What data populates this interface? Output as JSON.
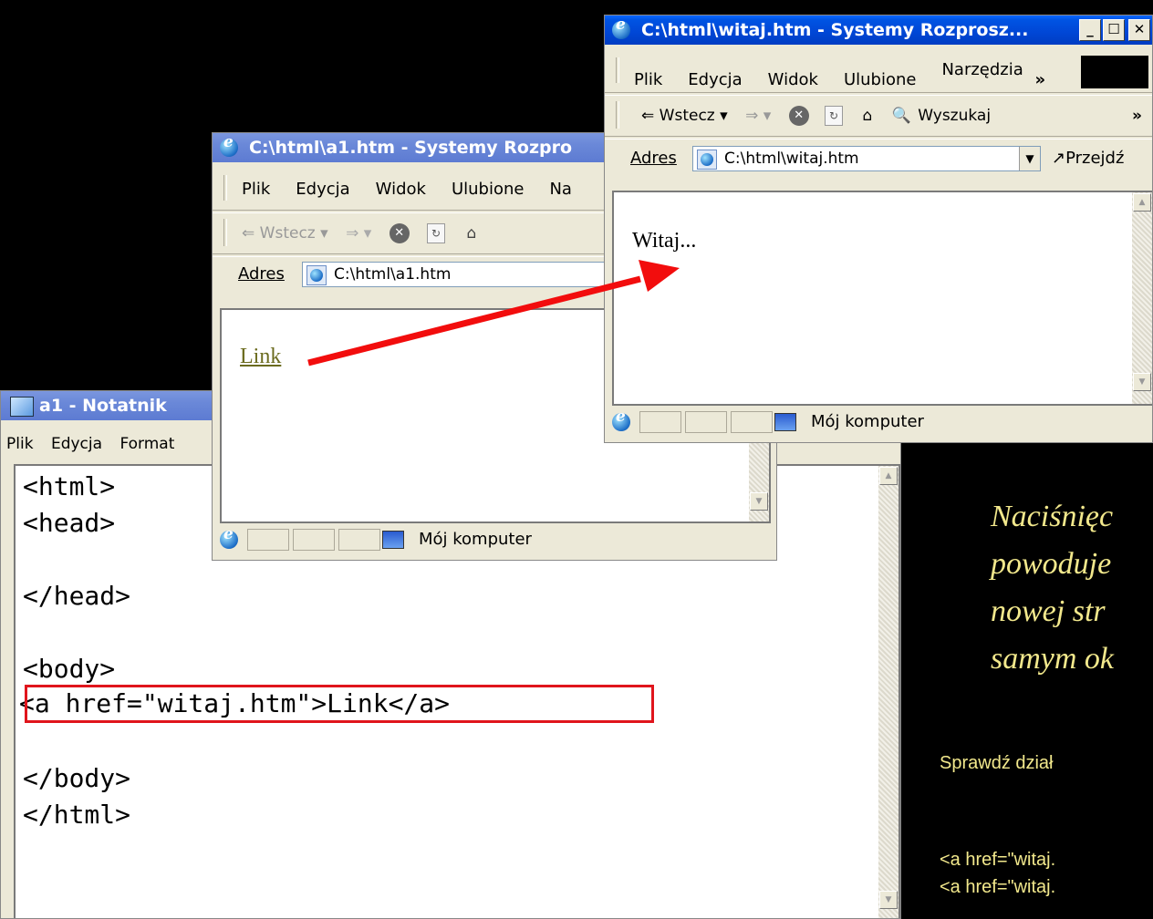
{
  "notepad": {
    "title": "a1 - Notatnik",
    "menu": [
      "Plik",
      "Edycja",
      "Format"
    ],
    "lines": [
      "<html>",
      "<head>",
      "",
      "</head>",
      "",
      "<body>",
      "<a href=\"witaj.htm\">Link</a>",
      "",
      "</body>",
      "</html>"
    ]
  },
  "browser_a1": {
    "title": "C:\\html\\a1.htm - Systemy Rozpro",
    "menu": [
      "Plik",
      "Edycja",
      "Widok",
      "Ulubione",
      "Na"
    ],
    "back": "Wstecz",
    "address_label": "Adres",
    "address": "C:\\html\\a1.htm",
    "link_text": "Link",
    "status_zone": "Mój komputer"
  },
  "browser_witaj": {
    "title": "C:\\html\\witaj.htm - Systemy Rozprosz...",
    "menu": [
      "Plik",
      "Edycja",
      "Widok",
      "Ulubione",
      "Narzędzia"
    ],
    "chevron": "»",
    "back": "Wstecz",
    "search": "Wyszukaj",
    "address_label": "Adres",
    "address": "C:\\html\\witaj.htm",
    "go": "Przejdź",
    "page_text": "Witaj...",
    "status_zone": "Mój komputer"
  },
  "caption": {
    "lines": [
      "Naciśnięc",
      "powoduje",
      "nowej str",
      "samym ok"
    ],
    "check": "Sprawdź dział",
    "examples": [
      "<a href=\"witaj.",
      "<a href=\"witaj."
    ]
  },
  "colors": {
    "highlight": "#e0151c",
    "arrow": "#f20d0d",
    "caption": "#f2e88c",
    "link": "#6b6b1e"
  }
}
